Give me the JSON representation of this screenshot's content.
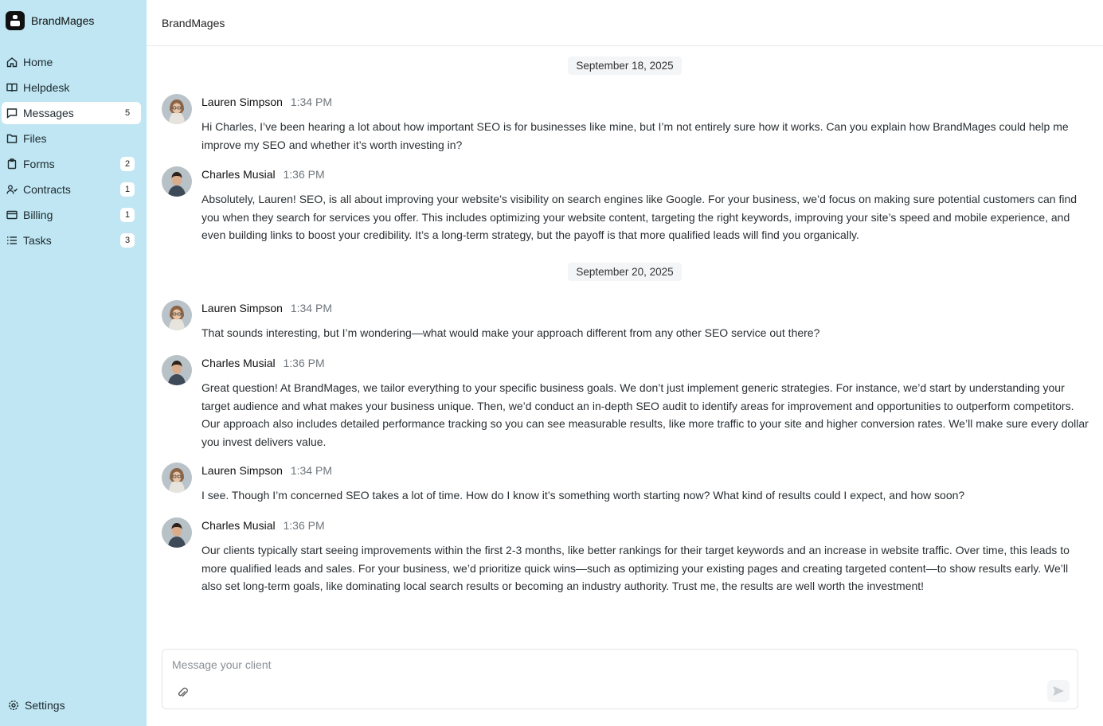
{
  "app": {
    "name": "BrandMages"
  },
  "sidebar": {
    "items": [
      {
        "label": "Home",
        "icon": "home-icon",
        "badge": ""
      },
      {
        "label": "Helpdesk",
        "icon": "book-icon",
        "badge": ""
      },
      {
        "label": "Messages",
        "icon": "message-icon",
        "badge": "5",
        "active": true
      },
      {
        "label": "Files",
        "icon": "folder-icon",
        "badge": ""
      },
      {
        "label": "Forms",
        "icon": "clipboard-icon",
        "badge": "2"
      },
      {
        "label": "Contracts",
        "icon": "handshake-icon",
        "badge": "1"
      },
      {
        "label": "Billing",
        "icon": "credit-card-icon",
        "badge": "1"
      },
      {
        "label": "Tasks",
        "icon": "list-icon",
        "badge": "3"
      }
    ],
    "settings_label": "Settings"
  },
  "header": {
    "title": "BrandMages"
  },
  "dates": [
    "September 18, 2025",
    "September 20, 2025"
  ],
  "messages": [
    {
      "name": "Lauren Simpson",
      "time": "1:34 PM",
      "text": "Hi Charles, I’ve been hearing a lot about how important SEO is for businesses like mine, but I’m not entirely sure how it works. Can you explain how BrandMages could help me improve my SEO and whether it’s worth investing in?"
    },
    {
      "name": "Charles Musial",
      "time": "1:36 PM",
      "text": "Absolutely, Lauren! SEO, is all about improving your website’s visibility on search engines like Google. For your business, we’d focus on making sure potential customers can find you when they search for services you offer. This includes optimizing your website content, targeting the right keywords, improving your site’s speed and mobile experience, and even building links to boost your credibility. It’s a long-term strategy, but the payoff is that more qualified leads will find you organically."
    },
    {
      "name": "Lauren Simpson",
      "time": "1:34 PM",
      "text": "That sounds interesting, but I’m wondering—what would make your approach different from any other SEO service out there?"
    },
    {
      "name": "Charles Musial",
      "time": "1:36 PM",
      "text": "Great question! At BrandMages, we tailor everything to your specific business goals. We don’t just implement generic strategies. For instance, we’d start by understanding your target audience and what makes your business unique. Then, we’d conduct an in-depth SEO audit to identify areas for improvement and opportunities to outperform competitors. Our approach also includes detailed performance tracking so you can see measurable results, like more traffic to your site and higher conversion rates. We’ll make sure every dollar you invest delivers value."
    },
    {
      "name": "Lauren Simpson",
      "time": "1:34 PM",
      "text": "I see. Though I’m concerned SEO takes a lot of time. How do I know it’s something worth starting now? What kind of results could I expect, and how soon?"
    },
    {
      "name": "Charles Musial",
      "time": "1:36 PM",
      "text": "Our clients typically start seeing improvements within the first 2-3 months, like better rankings for their target keywords and an increase in website traffic. Over time, this leads to more qualified leads and sales. For your business, we’d prioritize quick wins—such as optimizing your existing pages and creating targeted content—to show results early. We’ll also set long-term goals, like dominating local search results or becoming an industry authority. Trust me, the results are well worth the investment!"
    }
  ],
  "composer": {
    "placeholder": "Message your client"
  },
  "colors": {
    "sidebar_bg": "#bfe6f2",
    "active_item_bg": "#ffffff"
  }
}
